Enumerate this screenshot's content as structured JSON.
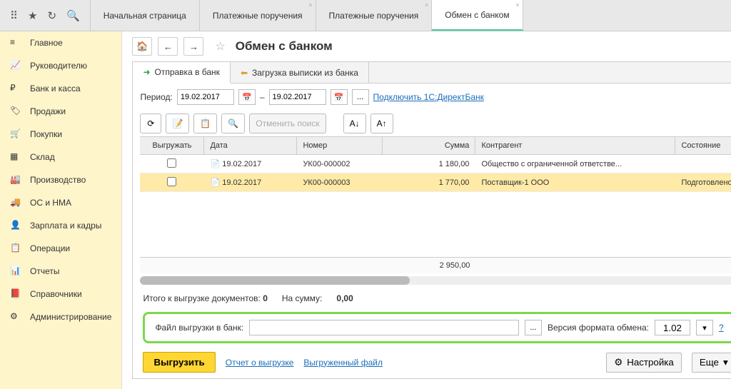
{
  "topTabs": [
    "Начальная страница",
    "Платежные поручения",
    "Платежные поручения",
    "Обмен с банком"
  ],
  "sidebar": {
    "items": [
      {
        "label": "Главное"
      },
      {
        "label": "Руководителю"
      },
      {
        "label": "Банк и касса"
      },
      {
        "label": "Продажи"
      },
      {
        "label": "Покупки"
      },
      {
        "label": "Склад"
      },
      {
        "label": "Производство"
      },
      {
        "label": "ОС и НМА"
      },
      {
        "label": "Зарплата и кадры"
      },
      {
        "label": "Операции"
      },
      {
        "label": "Отчеты"
      },
      {
        "label": "Справочники"
      },
      {
        "label": "Администрирование"
      }
    ]
  },
  "page": {
    "title": "Обмен с банком"
  },
  "subtabs": {
    "send": "Отправка в банк",
    "load": "Загрузка выписки из банка"
  },
  "period": {
    "label": "Период:",
    "from": "19.02.2017",
    "to": "19.02.2017",
    "dash": "–",
    "dots": "...",
    "link": "Подключить 1С:ДиректБанк"
  },
  "toolbar": {
    "cancel": "Отменить поиск"
  },
  "grid": {
    "headers": {
      "check": "Выгружать",
      "date": "Дата",
      "num": "Номер",
      "sum": "Сумма",
      "agent": "Контрагент",
      "state": "Состояние"
    },
    "rows": [
      {
        "date": "19.02.2017",
        "num": "УК00-000002",
        "sum": "1 180,00",
        "agent": "Общество с ограниченной ответстве...",
        "state": ""
      },
      {
        "date": "19.02.2017",
        "num": "УК00-000003",
        "sum": "1 770,00",
        "agent": "Поставщик-1 ООО",
        "state": "Подготовлено"
      }
    ],
    "total": "2 950,00"
  },
  "summary": {
    "docs_label": "Итого к выгрузке документов:",
    "docs_val": "0",
    "sum_label": "На сумму:",
    "sum_val": "0,00"
  },
  "file": {
    "label": "Файл выгрузки в банк:",
    "browse": "...",
    "fmt_label": "Версия формата обмена:",
    "fmt_val": "1.02",
    "help": "?"
  },
  "bottom": {
    "export": "Выгрузить",
    "report": "Отчет о выгрузке",
    "file": "Выгруженный файл",
    "settings": "Настройка",
    "more": "Еще"
  }
}
